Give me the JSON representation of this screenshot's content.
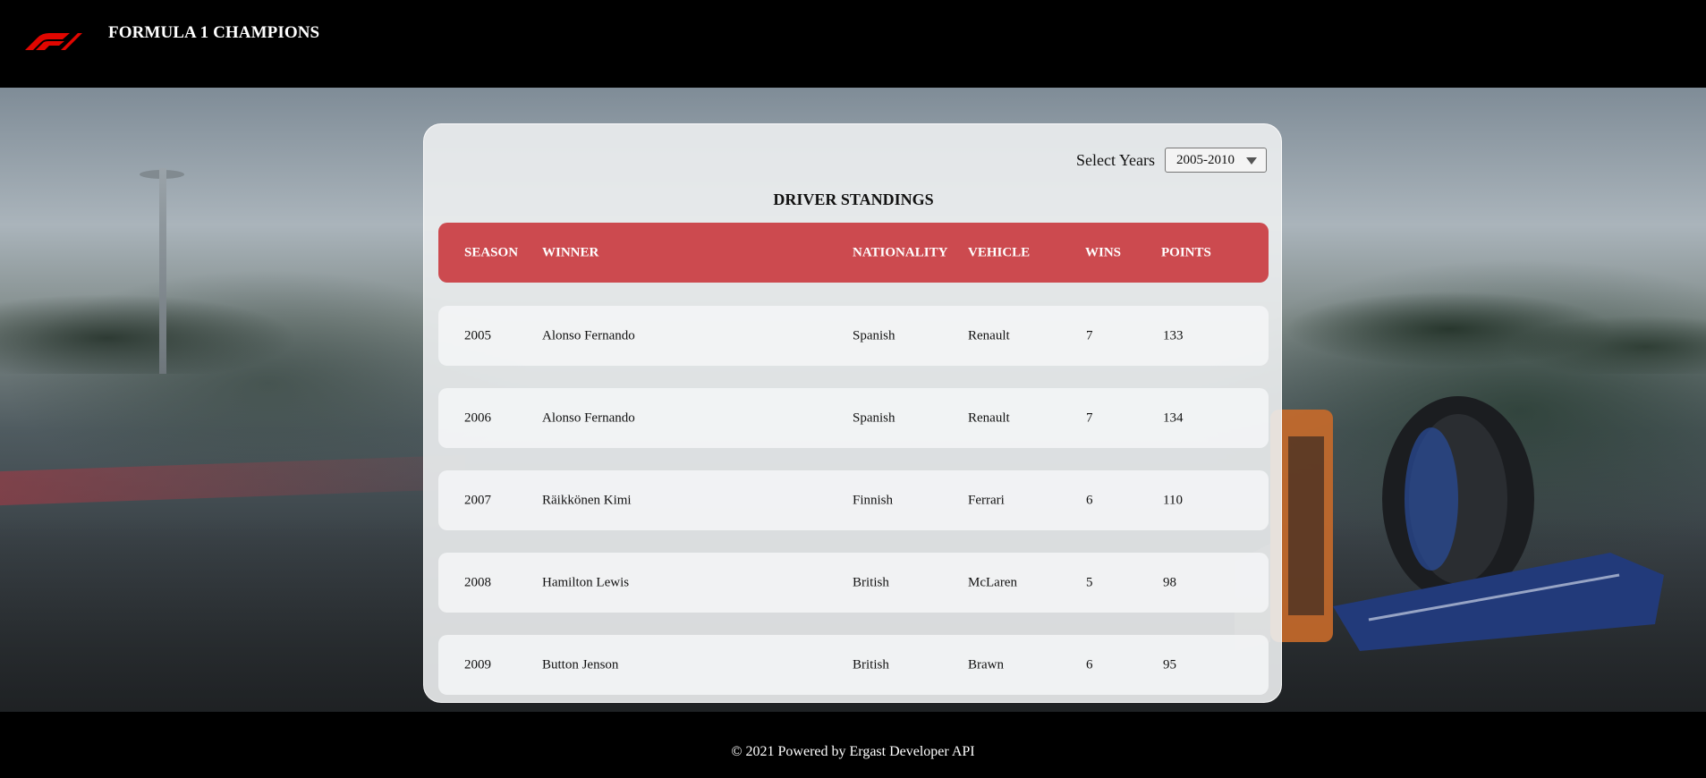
{
  "header": {
    "logo_icon": "f1-logo-icon",
    "title": "FORMULA 1 CHAMPIONS",
    "brand_color": "#e10600"
  },
  "filter": {
    "label": "Select Years",
    "selected": "2005-2010"
  },
  "standings": {
    "title": "DRIVER STANDINGS",
    "header_color": "#cc4a4f",
    "columns": {
      "season": "SEASON",
      "winner": "WINNER",
      "nationality": "NATIONALITY",
      "vehicle": "VEHICLE",
      "wins": "WINS",
      "points": "POINTS"
    },
    "rows": [
      {
        "season": "2005",
        "winner": "Alonso Fernando",
        "nationality": "Spanish",
        "vehicle": "Renault",
        "wins": "7",
        "points": "133"
      },
      {
        "season": "2006",
        "winner": "Alonso Fernando",
        "nationality": "Spanish",
        "vehicle": "Renault",
        "wins": "7",
        "points": "134"
      },
      {
        "season": "2007",
        "winner": "Räikkönen Kimi",
        "nationality": "Finnish",
        "vehicle": "Ferrari",
        "wins": "6",
        "points": "110"
      },
      {
        "season": "2008",
        "winner": "Hamilton Lewis",
        "nationality": "British",
        "vehicle": "McLaren",
        "wins": "5",
        "points": "98"
      },
      {
        "season": "2009",
        "winner": "Button Jenson",
        "nationality": "British",
        "vehicle": "Brawn",
        "wins": "6",
        "points": "95"
      }
    ]
  },
  "footer": {
    "text": "© 2021 Powered by Ergast Developer API"
  }
}
